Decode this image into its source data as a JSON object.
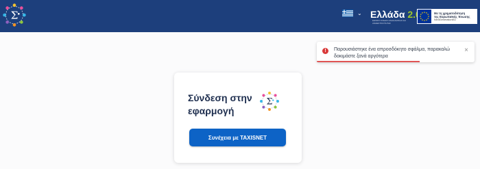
{
  "header": {
    "logo_icon": "sigma-network-logo-icon",
    "language": {
      "flag_icon": "greek-flag-icon",
      "dropdown_icon": "chevron-down-icon"
    },
    "greece20": {
      "title": "Ελλάδα",
      "version": "2.0",
      "subtitle": "ΕΘΝΙΚΟ ΣΧΕΔΙΟ ΑΝΑΚΑΜΨΗΣ ΚΑΙ ΑΝΘΕΚΤΙΚΟΤΗΤΑΣ",
      "accent_color": "#9fc82b"
    },
    "eu_funding": {
      "flag_icon": "eu-flag-icon",
      "line1": "Με τη χρηματοδότηση",
      "line2": "της Ευρωπαϊκής Ένωσης",
      "line3": "NextGenerationEU"
    }
  },
  "toast": {
    "icon": "error-icon",
    "message": "Παρουσιάστηκε ένα απροσδόκητο σφάλμα, παρακαλώ δοκιμάστε ξανά αργότερα",
    "close_symbol": "×",
    "progress": 0.65,
    "color": "#e05454"
  },
  "login_card": {
    "title": "Σύνδεση στην εφαρμογή",
    "logo_icon": "sigma-network-logo-icon",
    "button_label": "Συνέχεια με TAXISNET"
  },
  "colors": {
    "header_bg": "#1d3f7c",
    "primary_button": "#0d63c6",
    "page_bg": "#fbfbfc"
  }
}
